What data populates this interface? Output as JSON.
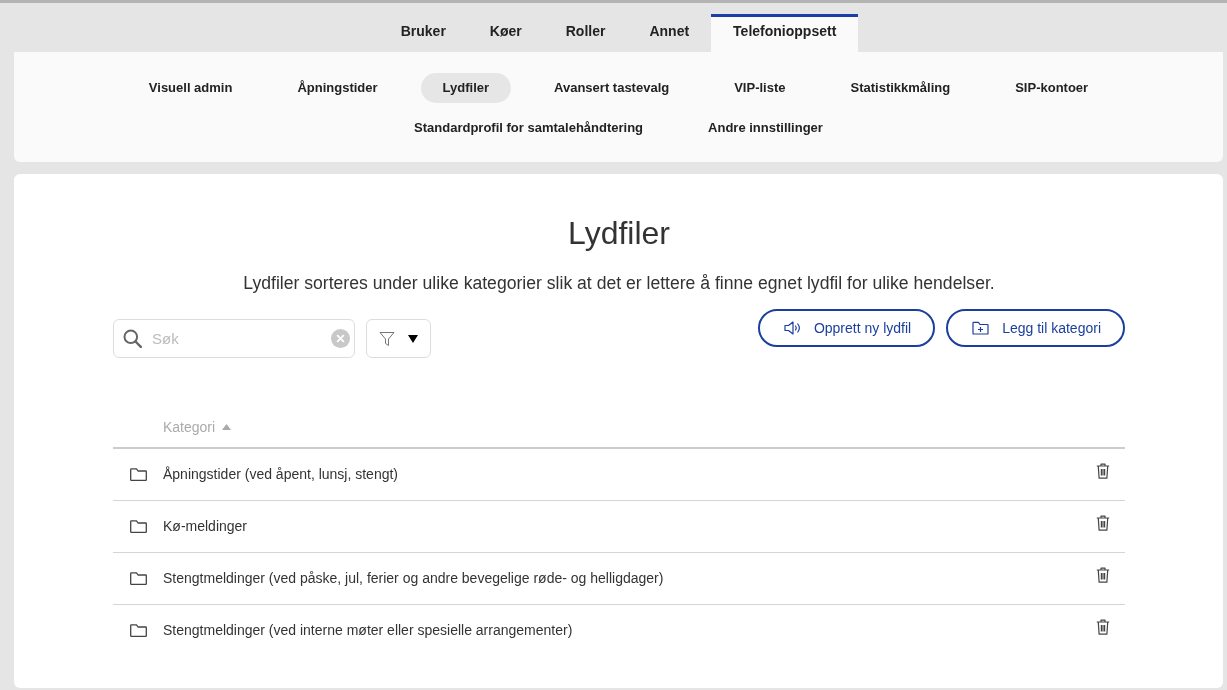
{
  "tabs": [
    {
      "label": "Bruker",
      "selected": false
    },
    {
      "label": "Køer",
      "selected": false
    },
    {
      "label": "Roller",
      "selected": false
    },
    {
      "label": "Annet",
      "selected": false
    },
    {
      "label": "Telefonioppsett",
      "selected": true
    }
  ],
  "subnav": [
    {
      "label": "Visuell admin",
      "selected": false
    },
    {
      "label": "Åpningstider",
      "selected": false
    },
    {
      "label": "Lydfiler",
      "selected": true
    },
    {
      "label": "Avansert tastevalg",
      "selected": false
    },
    {
      "label": "VIP-liste",
      "selected": false
    },
    {
      "label": "Statistikkmåling",
      "selected": false
    },
    {
      "label": "SIP-kontoer",
      "selected": false
    },
    {
      "label": "Standardprofil for samtalehåndtering",
      "selected": false
    },
    {
      "label": "Andre innstillinger",
      "selected": false
    }
  ],
  "page": {
    "title": "Lydfiler",
    "description": "Lydfiler sorteres under ulike kategorier slik at det er lettere å finne egnet lydfil for ulike hendelser."
  },
  "search": {
    "placeholder": "Søk"
  },
  "actions": [
    {
      "label": "Opprett ny lydfil"
    },
    {
      "label": "Legg til kategori"
    }
  ],
  "table": {
    "columns": [
      {
        "label": "Kategori",
        "sorted": true
      }
    ],
    "rows": [
      {
        "name": "Åpningstider (ved åpent, lunsj, stengt)"
      },
      {
        "name": "Kø-meldinger"
      },
      {
        "name": "Stengtmeldinger (ved påske, jul, ferier og andre bevegelige røde- og helligdager)"
      },
      {
        "name": "Stengtmeldinger (ved interne møter eller spesielle arrangementer)"
      }
    ]
  }
}
